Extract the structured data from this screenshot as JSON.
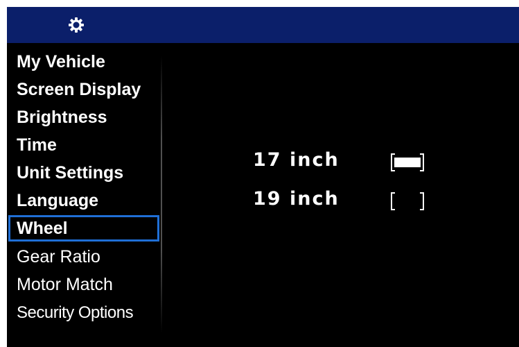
{
  "header": {
    "icon": "gear-icon",
    "background": "#0b1f6a"
  },
  "menu": {
    "items": [
      {
        "label": "My Vehicle"
      },
      {
        "label": "Screen Display"
      },
      {
        "label": "Brightness"
      },
      {
        "label": "Time"
      },
      {
        "label": "Unit Settings"
      },
      {
        "label": "Language"
      },
      {
        "label": "Wheel"
      },
      {
        "label": "Gear Ratio"
      },
      {
        "label": "Motor Match"
      },
      {
        "label": "Security Options"
      }
    ],
    "selected": "Wheel",
    "selection_color": "#1f6fd6"
  },
  "wheel_options": [
    {
      "label": "17 inch",
      "checked": true
    },
    {
      "label": "19 inch",
      "checked": false
    }
  ]
}
